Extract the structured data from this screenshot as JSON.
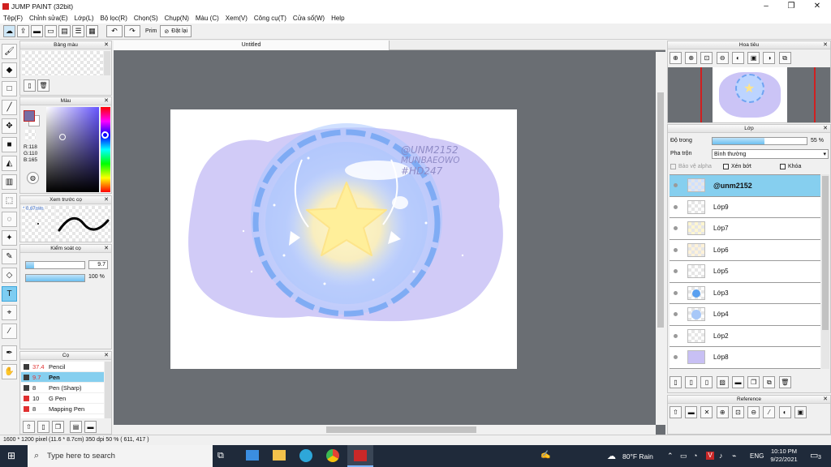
{
  "window": {
    "title": "JUMP PAINT (32bit)"
  },
  "menu": [
    "Tệp(F)",
    "Chỉnh sửa(E)",
    "Lớp(L)",
    "Bộ lọc(R)",
    "Chọn(S)",
    "Chụp(N)",
    "Màu (C)",
    "Xem(V)",
    "Công cụ(T)",
    "Cửa sổ(W)",
    "Help"
  ],
  "toolbar": {
    "prim_label": "Prim",
    "reset_label": "Đặt lại"
  },
  "panels": {
    "swatch_title": "Bảng màu",
    "color_title": "Màu",
    "rgb": {
      "r": "R:118",
      "g": "G:110",
      "b": "B:165"
    },
    "preview_title": "Xem trước cọ",
    "preview_size": "* 0.67mm",
    "brush_control_title": "Kiểm soát cọ",
    "brush_size_value": "9.7",
    "brush_opacity_value": "100 %",
    "brush_list_title": "Cọ",
    "brushes": [
      {
        "size": "37.4",
        "name": "Pencil",
        "color": "#3a3a3a",
        "selected": false
      },
      {
        "size": "9.7",
        "name": "Pen",
        "color": "#3a3a3a",
        "selected": true
      },
      {
        "size": "8",
        "name": "Pen (Sharp)",
        "color": "#3a3a3a",
        "selected": false
      },
      {
        "size": "10",
        "name": "G Pen",
        "color": "#e03030",
        "selected": false
      },
      {
        "size": "8",
        "name": "Mapping Pen",
        "color": "#e03030",
        "selected": false
      }
    ]
  },
  "canvas": {
    "tab_title": "Untitled",
    "watermark": [
      "@UNM2152",
      "MUNBAEOWO",
      "#HD247"
    ]
  },
  "navigator": {
    "title": "Hoa tiêu"
  },
  "layers": {
    "title": "Lớp",
    "opacity_label": "Độ trong",
    "opacity_value": "55 %",
    "opacity_fraction": 0.55,
    "blend_label": "Pha trộn",
    "blend_value": "Bình thường",
    "protect_label": "Bảo vệ alpha",
    "clip_label": "Xén bớt",
    "lock_label": "Khóa",
    "items": [
      {
        "name": "@unm2152",
        "selected": true,
        "thumb": "#cfe0ff"
      },
      {
        "name": "Lớp9",
        "selected": false,
        "thumb": ""
      },
      {
        "name": "Lớp7",
        "selected": false,
        "thumb": "#fff6d0"
      },
      {
        "name": "Lớp6",
        "selected": false,
        "thumb": "#fff2d8"
      },
      {
        "name": "Lớp5",
        "selected": false,
        "thumb": ""
      },
      {
        "name": "Lớp3",
        "selected": false,
        "thumb": "#5aa0f0"
      },
      {
        "name": "Lớp4",
        "selected": false,
        "thumb": "#a8c8f8"
      },
      {
        "name": "Lớp2",
        "selected": false,
        "thumb": ""
      },
      {
        "name": "Lớp8",
        "selected": false,
        "thumb": "#c8c0f4"
      }
    ]
  },
  "reference": {
    "title": "Reference"
  },
  "status": {
    "text": "1600 * 1200 pixel  (11.6 * 8.7cm)  350 dpi  50 %  ( 611, 417 )"
  },
  "taskbar": {
    "search_placeholder": "Type here to search",
    "weather": "80°F  Rain",
    "lang": "ENG",
    "time": "10:10 PM",
    "date": "9/22/2021",
    "notif_count": "3"
  }
}
